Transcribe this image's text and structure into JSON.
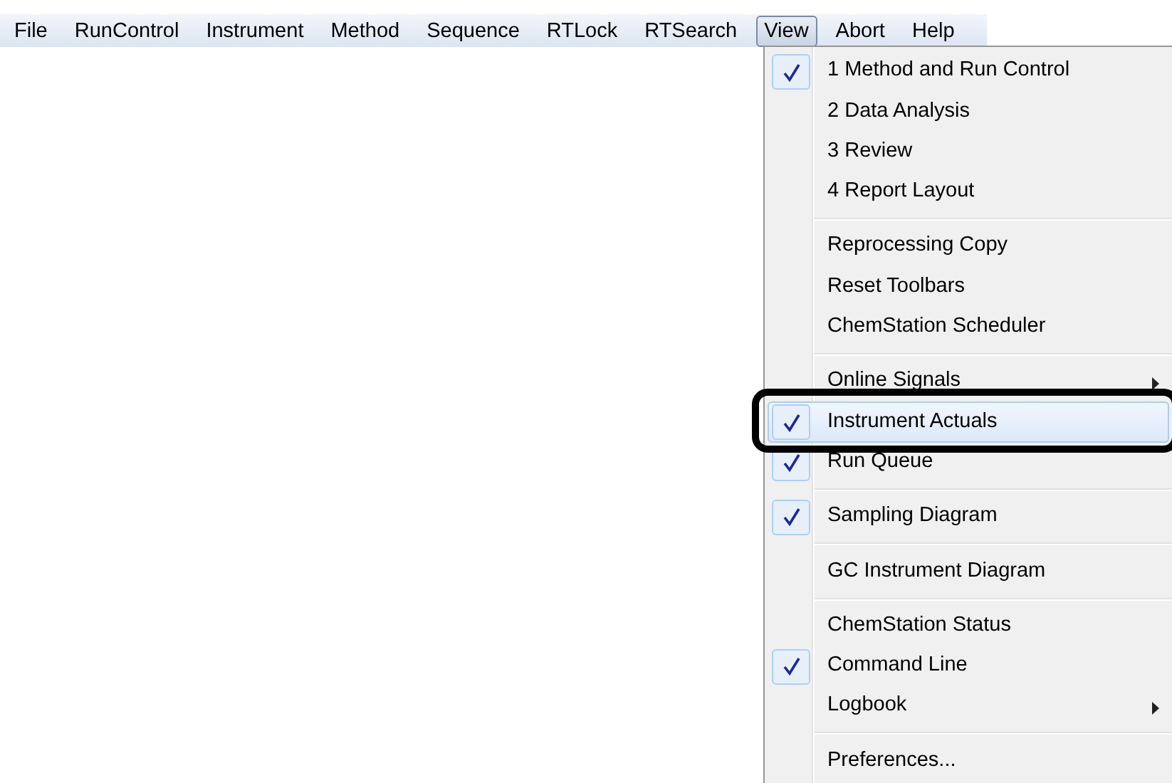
{
  "menubar": [
    {
      "label": "File",
      "selected": false
    },
    {
      "label": "RunControl",
      "selected": false
    },
    {
      "label": "Instrument",
      "selected": false
    },
    {
      "label": "Method",
      "selected": false
    },
    {
      "label": "Sequence",
      "selected": false
    },
    {
      "label": "RTLock",
      "selected": false
    },
    {
      "label": "RTSearch",
      "selected": false
    },
    {
      "label": "View",
      "selected": true
    },
    {
      "label": "Abort",
      "selected": false
    },
    {
      "label": "Help",
      "selected": false
    }
  ],
  "menu": {
    "groups": [
      {
        "items": [
          {
            "label": "1 Method and Run Control",
            "checked": true,
            "submenu": false,
            "selected": false
          },
          {
            "label": "2 Data Analysis",
            "checked": false,
            "submenu": false,
            "selected": false
          },
          {
            "label": "3 Review",
            "checked": false,
            "submenu": false,
            "selected": false
          },
          {
            "label": "4 Report Layout",
            "checked": false,
            "submenu": false,
            "selected": false
          }
        ]
      },
      {
        "items": [
          {
            "label": "Reprocessing Copy",
            "checked": false,
            "submenu": false,
            "selected": false
          },
          {
            "label": "Reset Toolbars",
            "checked": false,
            "submenu": false,
            "selected": false
          },
          {
            "label": "ChemStation Scheduler",
            "checked": false,
            "submenu": false,
            "selected": false
          }
        ]
      },
      {
        "items": [
          {
            "label": "Online Signals",
            "checked": false,
            "submenu": true,
            "selected": false
          },
          {
            "label": "Instrument Actuals",
            "checked": true,
            "submenu": false,
            "selected": true
          },
          {
            "label": "Run Queue",
            "checked": true,
            "submenu": false,
            "selected": false
          }
        ]
      },
      {
        "items": [
          {
            "label": "Sampling Diagram",
            "checked": true,
            "submenu": false,
            "selected": false
          }
        ]
      },
      {
        "items": [
          {
            "label": "GC Instrument Diagram",
            "checked": false,
            "submenu": false,
            "selected": false
          }
        ]
      },
      {
        "items": [
          {
            "label": "ChemStation Status",
            "checked": false,
            "submenu": false,
            "selected": false
          },
          {
            "label": "Command Line",
            "checked": true,
            "submenu": false,
            "selected": false
          },
          {
            "label": "Logbook",
            "checked": false,
            "submenu": true,
            "selected": false
          }
        ]
      },
      {
        "items": [
          {
            "label": "Preferences...",
            "checked": false,
            "submenu": false,
            "selected": false
          }
        ]
      }
    ]
  }
}
